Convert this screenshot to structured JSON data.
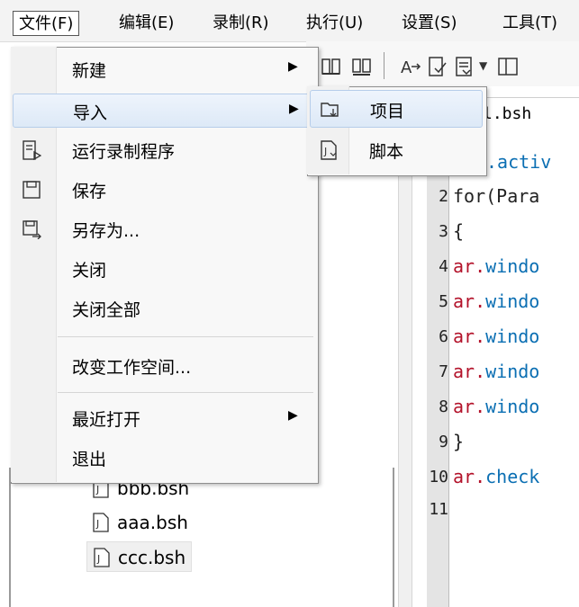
{
  "menubar": {
    "items": [
      {
        "label": "文件(F)"
      },
      {
        "label": "编辑(E)"
      },
      {
        "label": "录制(R)"
      },
      {
        "label": "执行(U)"
      },
      {
        "label": "设置(S)"
      },
      {
        "label": "工具(T)"
      }
    ]
  },
  "file_menu": {
    "new": "新建",
    "import": "导入",
    "run_recorder": "运行录制程序",
    "save": "保存",
    "save_as": "另存为...",
    "close": "关闭",
    "close_all": "关闭全部",
    "change_workspace": "改变工作空间...",
    "recent": "最近打开",
    "exit": "退出"
  },
  "import_submenu": {
    "project": "项目",
    "script": "脚本"
  },
  "editor": {
    "tab_label": "l.bsh",
    "line_numbers": [
      "2",
      "3",
      "4",
      "5",
      "6",
      "7",
      "8",
      "9",
      "10",
      "11"
    ],
    "lines": [
      {
        "text": ".activ",
        "color": "fn"
      },
      {
        "text": "for(Para",
        "color": "kw"
      },
      {
        "text": "{",
        "color": "kw"
      },
      {
        "prefix": "ar.",
        "rest": "windo"
      },
      {
        "prefix": "ar.",
        "rest": "windo"
      },
      {
        "prefix": "ar.",
        "rest": "windo"
      },
      {
        "prefix": "ar.",
        "rest": "windo"
      },
      {
        "prefix": "ar.",
        "rest": "windo"
      },
      {
        "text": "}",
        "color": "kw"
      },
      {
        "prefix": "ar.",
        "rest": "check"
      }
    ]
  },
  "tree": {
    "files": [
      "bbb.bsh",
      "aaa.bsh",
      "ccc.bsh"
    ]
  }
}
